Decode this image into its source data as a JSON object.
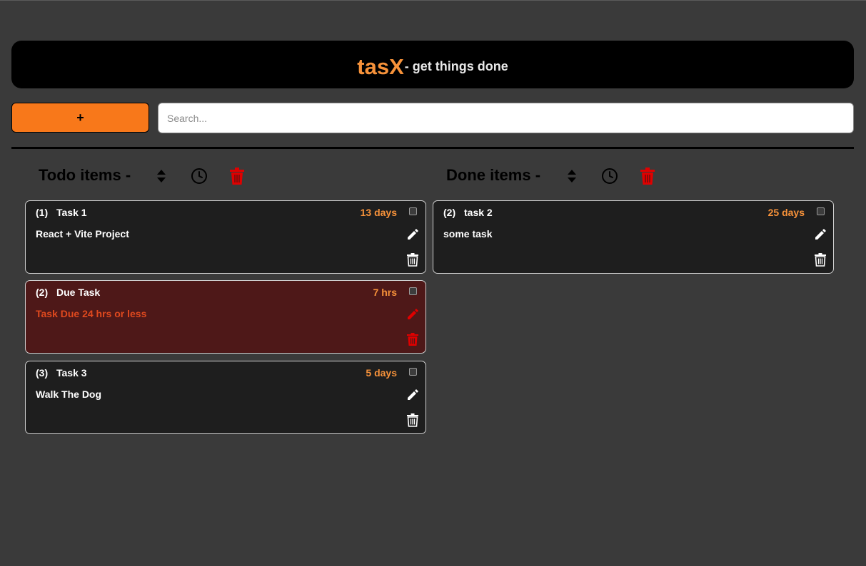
{
  "header": {
    "brand": "tasX",
    "tagline": "- get things done"
  },
  "toolbar": {
    "add_label": "+",
    "search_placeholder": "Search..."
  },
  "todo": {
    "title": "Todo items -",
    "items": [
      {
        "num": "(1)",
        "title": "Task 1",
        "time": "13 days",
        "desc": "React + Vite Project",
        "due": false
      },
      {
        "num": "(2)",
        "title": "Due Task",
        "time": "7 hrs",
        "desc": "Task Due 24 hrs or less",
        "due": true
      },
      {
        "num": "(3)",
        "title": "Task 3",
        "time": "5 days",
        "desc": "Walk The Dog",
        "due": false
      }
    ]
  },
  "done": {
    "title": "Done items -",
    "items": [
      {
        "num": "(2)",
        "title": "task 2",
        "time": "25 days",
        "desc": "some task",
        "due": false
      }
    ]
  },
  "colors": {
    "accent": "#f8781a",
    "brand": "#f7923a",
    "danger": "#e00000",
    "due_bg": "#4e1818"
  },
  "icons": [
    "sort-icon",
    "clock-icon",
    "trash-icon",
    "edit-icon",
    "checkbox"
  ]
}
